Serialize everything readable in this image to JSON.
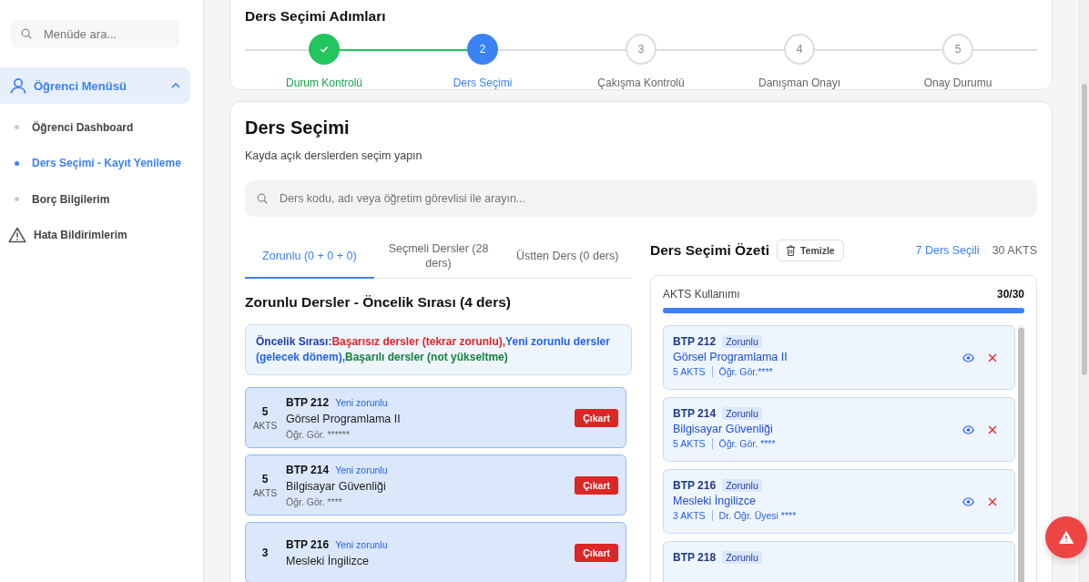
{
  "sidebar": {
    "search": {
      "placeholder": "Menüde ara..."
    },
    "group": {
      "label": "Öğrenci Menüsü",
      "expanded": true
    },
    "items": [
      {
        "label": "Öğrenci Dashboard",
        "selected": false
      },
      {
        "label": "Ders Seçimi - Kayıt Yenileme",
        "selected": true
      },
      {
        "label": "Borç Bilgilerim",
        "selected": false
      }
    ],
    "extra_item": {
      "label": "Hata Bildirimlerim"
    }
  },
  "steps": {
    "title": "Ders Seçimi Adımları",
    "items": [
      {
        "label": "Durum Kontrolü",
        "completed": true,
        "selected": false
      },
      {
        "number": "2",
        "label": "Ders Seçimi",
        "completed": false,
        "selected": true
      },
      {
        "number": "3",
        "label": "Çakışma Kontrolü",
        "completed": false,
        "selected": false
      },
      {
        "number": "4",
        "label": "Danışman Onayı",
        "completed": false,
        "selected": false
      },
      {
        "number": "5",
        "label": "Onay Durumu",
        "completed": false,
        "selected": false
      }
    ]
  },
  "selection": {
    "title": "Ders Seçimi",
    "subtitle": "Kayda açık derslerden seçim yapın",
    "search": {
      "placeholder": "Ders kodu, adı veya öğretim görevlisi ile arayın..."
    },
    "tabs": [
      {
        "label": "Zorunlu (0 + 0 + 0)",
        "selected": true
      },
      {
        "label": "Seçmeli Dersler (28 ders)",
        "selected": false
      },
      {
        "label": "Üstten Ders (0 ders)",
        "selected": false
      }
    ],
    "heading": "Zorunlu Dersler - Öncelik Sırası (4 ders)",
    "priority_note": [
      {
        "text": "Öncelik Sırası:",
        "color": "#1e40af"
      },
      {
        "text": "Başarısız dersler (tekrar zorunlu),",
        "color": "#dc2626"
      },
      {
        "text": "Yeni zorunlu dersler (gelecek dönem),",
        "color": "#2563eb"
      },
      {
        "text": "Başarılı dersler (not yükseltme)",
        "color": "#15803d"
      }
    ],
    "courses": [
      {
        "akts": "5",
        "akts_unit": "AKTS",
        "code": "BTP 212",
        "tag": "Yeni zorunlu",
        "name": "Görsel Programlama II",
        "lecturer": "Öğr. Gör. ******",
        "button": "Çıkart"
      },
      {
        "akts": "5",
        "akts_unit": "AKTS",
        "code": "BTP 214",
        "tag": "Yeni zorunlu",
        "name": "Bilgisayar Güvenliği",
        "lecturer": "Öğr. Gör. ****",
        "button": "Çıkart"
      },
      {
        "akts": "3",
        "code": "BTP 216",
        "tag": "Yeni zorunlu",
        "name": "Mesleki İngilizce",
        "button": "Çıkart"
      }
    ]
  },
  "summary": {
    "title": "Ders Seçimi Özeti",
    "clear_button": "Temizle",
    "selected_count": "7 Ders Seçili",
    "total": "30 AKTS",
    "usage_label": "AKTS Kullanımı",
    "usage_reading": "30/30",
    "level": 1.0,
    "items": [
      {
        "code": "BTP 212",
        "tag": "Zorunlu",
        "name": "Görsel Programlama II",
        "akts": "5 AKTS",
        "lecturer": "Öğr. Gör.****"
      },
      {
        "code": "BTP 214",
        "tag": "Zorunlu",
        "name": "Bilgisayar Güvenliği",
        "akts": "5 AKTS",
        "lecturer": "Öğr. Gör. ****"
      },
      {
        "code": "BTP 216",
        "tag": "Zorunlu",
        "name": "Mesleki İngilizce",
        "akts": "3 AKTS",
        "lecturer": "Dr. Öğr. Üyesi ****"
      },
      {
        "code": "BTP 218",
        "tag": "Zorunlu"
      }
    ]
  }
}
